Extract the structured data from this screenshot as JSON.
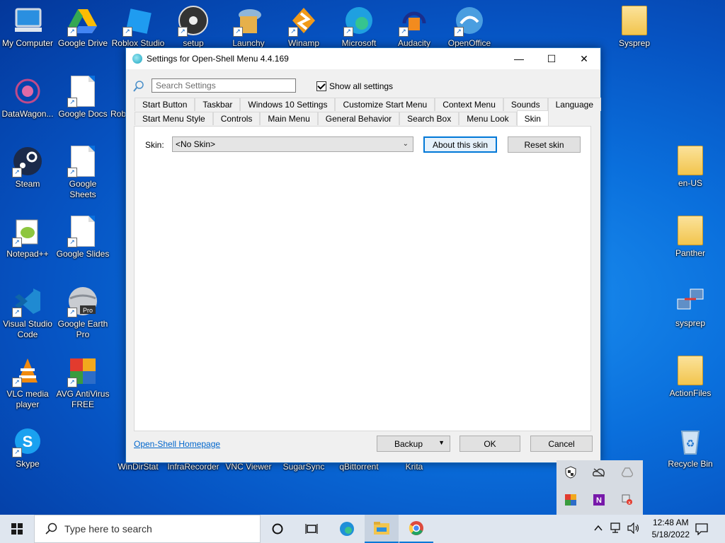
{
  "desktop": {
    "top_row": [
      "My Computer",
      "Google Drive",
      "Roblox Studio",
      "setup",
      "Launchy",
      "Winamp",
      "Microsoft",
      "Audacity",
      "OpenOffice"
    ],
    "sysprep_folder": "Sysprep",
    "col1": [
      "DataWagon...",
      "Steam",
      "Notepad++",
      "Visual Studio Code",
      "VLC media player",
      "Skype"
    ],
    "col2": [
      "Google Docs",
      "Google Sheets",
      "Google Slides",
      "Google Earth Pro",
      "AVG AntiVirus FREE"
    ],
    "col3_partial": [
      "Rob"
    ],
    "bottom_row": [
      "WinDirStat",
      "InfraRecorder",
      "VNC Viewer",
      "SugarSync",
      "qBittorrent",
      "Krita"
    ],
    "right_col": [
      "en-US",
      "Panther",
      "sysprep",
      "ActionFiles",
      "Recycle Bin"
    ]
  },
  "window": {
    "title": "Settings for Open-Shell Menu 4.4.169",
    "controls": {
      "minimize": "—",
      "maximize": "☐",
      "close": "✕"
    },
    "search_placeholder": "Search Settings",
    "show_all_label": "Show all settings",
    "tabs_row1": [
      "Start Button",
      "Taskbar",
      "Windows 10 Settings",
      "Customize Start Menu",
      "Context Menu",
      "Sounds",
      "Language"
    ],
    "tabs_row2": [
      "Start Menu Style",
      "Controls",
      "Main Menu",
      "General Behavior",
      "Search Box",
      "Menu Look",
      "Skin"
    ],
    "active_tab": "Skin",
    "skin_label": "Skin:",
    "skin_value": "<No Skin>",
    "about_skin_button": "About this skin",
    "reset_skin_button": "Reset skin",
    "homepage_link": "Open-Shell Homepage",
    "backup_button": "Backup",
    "ok_button": "OK",
    "cancel_button": "Cancel"
  },
  "taskbar": {
    "search_placeholder": "Type here to search",
    "time": "12:48 AM",
    "date": "5/18/2022"
  },
  "colors": {
    "accent": "#0078d7",
    "desktop": "#0a6fdc",
    "link": "#0066cc"
  }
}
